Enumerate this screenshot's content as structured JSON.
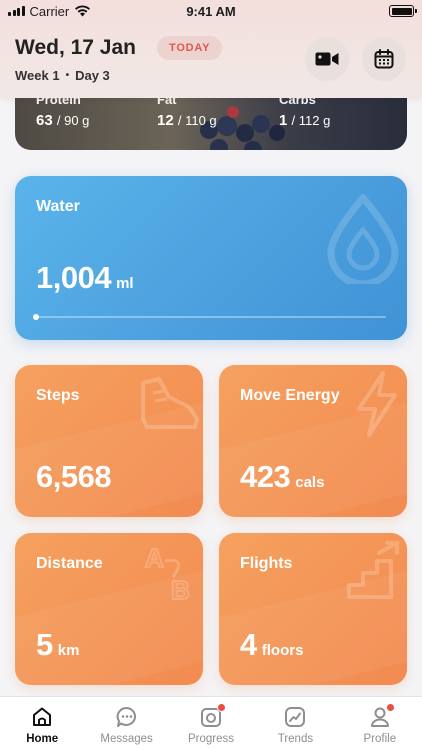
{
  "status_bar": {
    "carrier": "Carrier",
    "time": "9:41 AM"
  },
  "header": {
    "date": "Wed, 17 Jan",
    "badge": "TODAY",
    "week": "Week 1",
    "separator": "•",
    "day": "Day 3",
    "video_icon": "video-camera-icon",
    "calendar_icon": "calendar-icon"
  },
  "nutrition": {
    "protein": {
      "label": "Protein",
      "value": "63",
      "target": "/ 90 g"
    },
    "fat": {
      "label": "Fat",
      "value": "12",
      "target": "/ 110 g"
    },
    "carbs": {
      "label": "Carbs",
      "value": "1",
      "target": "/ 112 g"
    }
  },
  "water": {
    "label": "Water",
    "value": "1,004",
    "unit": "ml",
    "progress": 0.0,
    "icon": "droplet-icon",
    "color": "#4b9fdd"
  },
  "steps": {
    "label": "Steps",
    "value": "6,568",
    "unit": "",
    "icon": "shoe-icon"
  },
  "move_energy": {
    "label": "Move Energy",
    "value": "423",
    "unit": "cals",
    "icon": "lightning-icon"
  },
  "distance": {
    "label": "Distance",
    "value": "5",
    "unit": "km",
    "icon": "a-to-b-icon"
  },
  "flights": {
    "label": "Flights",
    "value": "4",
    "unit": "floors",
    "icon": "stairs-icon"
  },
  "colors": {
    "accent_orange": "#f49456",
    "badge_red": "#e2574c",
    "notification": "#ef4b3f"
  },
  "tabs": [
    {
      "label": "Home",
      "icon": "home-icon",
      "active": true,
      "badge": false
    },
    {
      "label": "Messages",
      "icon": "chat-icon",
      "active": false,
      "badge": false
    },
    {
      "label": "Progress",
      "icon": "camera-icon",
      "active": false,
      "badge": true
    },
    {
      "label": "Trends",
      "icon": "trend-chart-icon",
      "active": false,
      "badge": false
    },
    {
      "label": "Profile",
      "icon": "person-icon",
      "active": false,
      "badge": true
    }
  ]
}
